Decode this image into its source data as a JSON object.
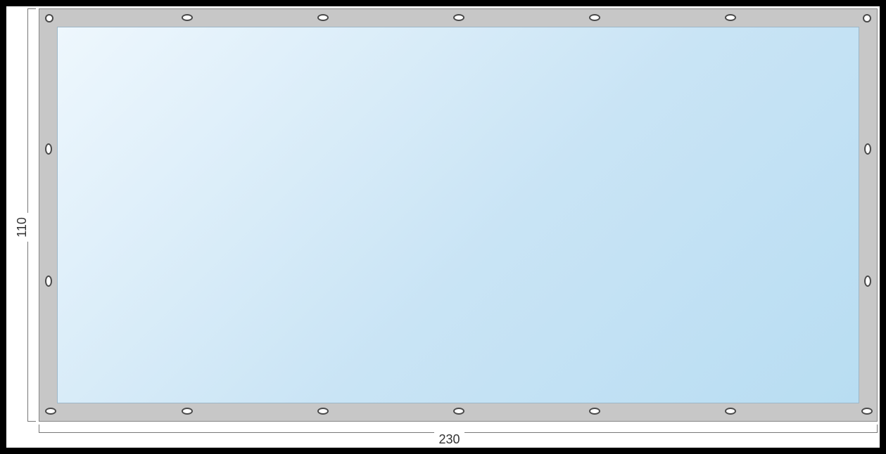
{
  "dimensions": {
    "width_label": "230",
    "height_label": "110"
  },
  "panel": {
    "frame_color": "#c7c7c7",
    "glass_gradient_start": "#eef7fd",
    "glass_gradient_end": "#b8ddf2"
  },
  "eyelets": {
    "top_count": 7,
    "bottom_count": 7,
    "left_count": 2,
    "right_count": 2,
    "corners": 4
  }
}
